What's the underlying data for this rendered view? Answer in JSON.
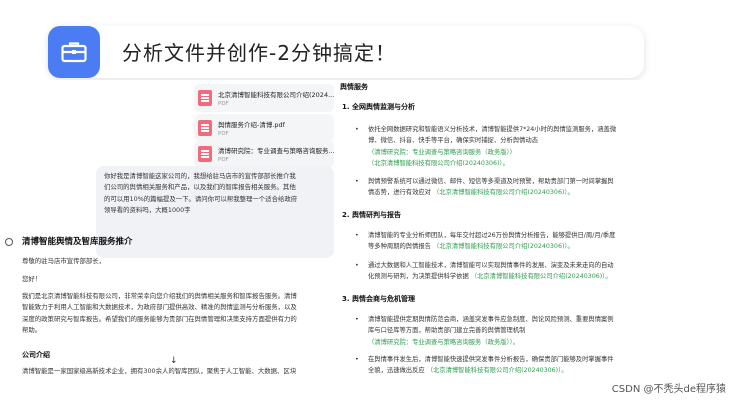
{
  "banner": {
    "icon": "briefcase-icon",
    "title": "分析文件并创作-2分钟搞定！",
    "accent": "#4b7cf3"
  },
  "files": [
    {
      "name": "北京清博智能科技有限公司介绍(2024...",
      "type": "PDF"
    },
    {
      "name": "舆情服务介绍-清博.pdf",
      "type": "PDF"
    },
    {
      "name": "清博研究院：专业调查与策略咨询服务...",
      "type": "PDF"
    }
  ],
  "user_message": {
    "lines": [
      "你好我是清博智能这家公司的，我想给驻马店市的宣传部部长推介我",
      "们公司的舆情相关服务和产品，以及我们的智库报告相关服务。其他",
      "的可以用10%的篇幅提及一下。请问你可以帮我整理一个适合给政府",
      "领导看的资料吗，大概1000字"
    ]
  },
  "bot": {
    "icon": "assistant-icon",
    "title": "清博智能舆情及智库服务推介",
    "greeting": "尊敬的驻马店市宣传部部长，",
    "hello": "您好！",
    "intro_lines": [
      "我们是北京清博智能科技有限公司，非常荣幸向您介绍我们的舆情相关服务和智库报告服务。清博",
      "智能致力于利用人工智能和大数据技术，为政府部门提供高效、精准的舆情监测与分析服务，以及",
      "深度的政策研究与智库报告。希望我们的服务能够为贵部门在舆情管理和决策支持方面提供有力的",
      "帮助。"
    ],
    "subtitle": "公司介绍",
    "company_line": "清博智能是一家国家级高新技术企业，拥有300余人的智库团队，聚焦于人工智能、大数据、区块"
  },
  "right": {
    "heading": "舆情服务",
    "sections": [
      {
        "title": "1.   全网舆情监测与分析",
        "bullets": [
          {
            "text": [
              "依托全网数据研究和智能语义分析技术，清博智能提供7*24小时的舆情监测服务，涵盖微",
              "博、微信、抖音、快手等平台，确保实时捕捉、分析舆情动态"
            ],
            "sources": [
              "（清博研究院：专业调查与策略咨询服务（政务版））",
              "（北京清博智能科技有限公司介绍(20240306)）。"
            ]
          },
          {
            "text": [
              "舆情预警系统可以通过微信、邮件、短信等多渠道及时预警，帮助贵部门第一时间掌握舆",
              "情态势，进行有效应对"
            ],
            "sources": [
              "（北京清博智能科技有限公司介绍(20240306)）。"
            ]
          }
        ]
      },
      {
        "title": "2.   舆情研判与报告",
        "bullets": [
          {
            "text": [
              "清博智能的专业分析师团队，每年交付超过26万份舆情分析报告，能够提供日/周/月/季度",
              "等多种周期的舆情报告"
            ],
            "sources": [
              "（北京清博智能科技有限公司介绍(20240306)）。"
            ]
          },
          {
            "text": [
              "通过大数据和人工智能技术，清博智能可以实现舆情事件的发展、演变及未来走向的自动",
              "化预测与研判，为决策提供科学依据"
            ],
            "sources": [
              "（北京清博智能科技有限公司介绍(20240306)）。"
            ]
          }
        ]
      },
      {
        "title": "3.   舆情会商与危机管理",
        "bullets": [
          {
            "text": [
              "清博智能提供定期舆情防范会商，涵盖突发事件应急制度、舆论风险预测、重要舆情案例",
              "库与口径库等方面，帮助贵部门建立完善的舆情管理机制"
            ],
            "sources": [
              "（清博研究院：专业调查与策略咨询服务（政务版））。"
            ]
          },
          {
            "text": [
              "在舆情事件发生后，清博智能快速提供突发事件分析报告，确保贵部门能够及时掌握事件",
              "全貌，迅速做出反应"
            ],
            "sources": [
              "（北京清博智能科技有限公司介绍(20240306)）。"
            ]
          }
        ]
      }
    ]
  },
  "watermark": "CSDN @不秃头de程序猿"
}
